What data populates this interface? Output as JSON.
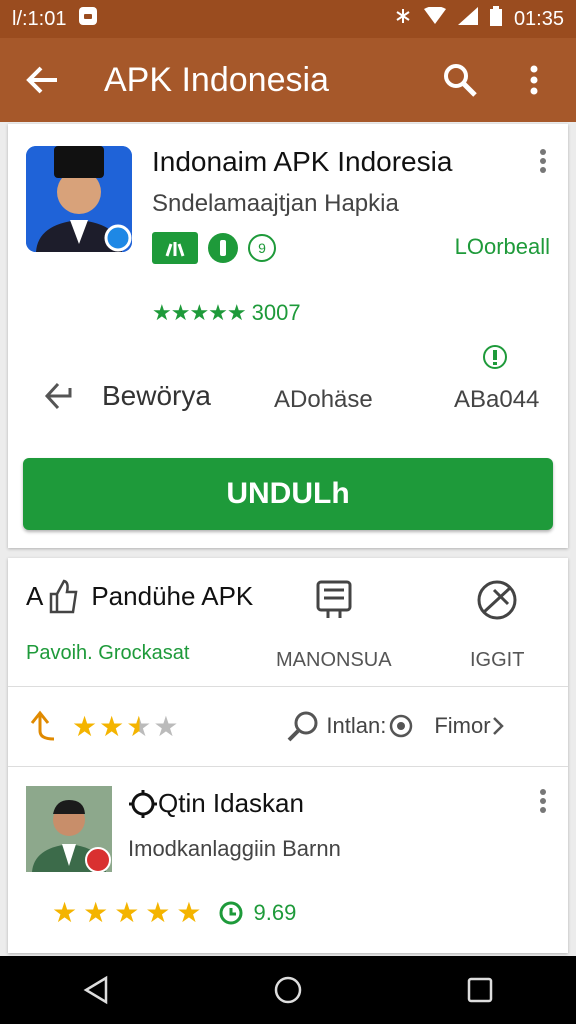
{
  "status_bar": {
    "time_left": "Ɩ/:1:01",
    "time_right": "01:35"
  },
  "appbar": {
    "title": "APK Indonesia"
  },
  "app": {
    "title": "Indonaim APK Indoresia",
    "developer": "Sndelamaajtjan Hapkia",
    "category": "LOorbeall",
    "rating_count": "3007",
    "badge_circle": "9",
    "stats": {
      "back_label": "Bewörya",
      "mid_label": "ADohäse",
      "right_label": "ABa044"
    },
    "download_label": "UNDULh"
  },
  "features": [
    {
      "label": "Pandühe APK",
      "prefix": "A",
      "sub": "Pavoih. Grockasat"
    },
    {
      "label": "",
      "sub": "MANONSUA"
    },
    {
      "label": "",
      "sub": "IGGIT"
    }
  ],
  "rating_row": {
    "search_label": "Intlan:",
    "more_label": "Fimor"
  },
  "review": {
    "title": "Qtin Idaskan",
    "subtitle": "Imodkanlaggiin Barnn",
    "score": "9.69"
  },
  "colors": {
    "accent": "#1e9a3a",
    "appbar": "#a6582a",
    "statusbar": "#9a4c1f",
    "star": "#f4b400"
  }
}
